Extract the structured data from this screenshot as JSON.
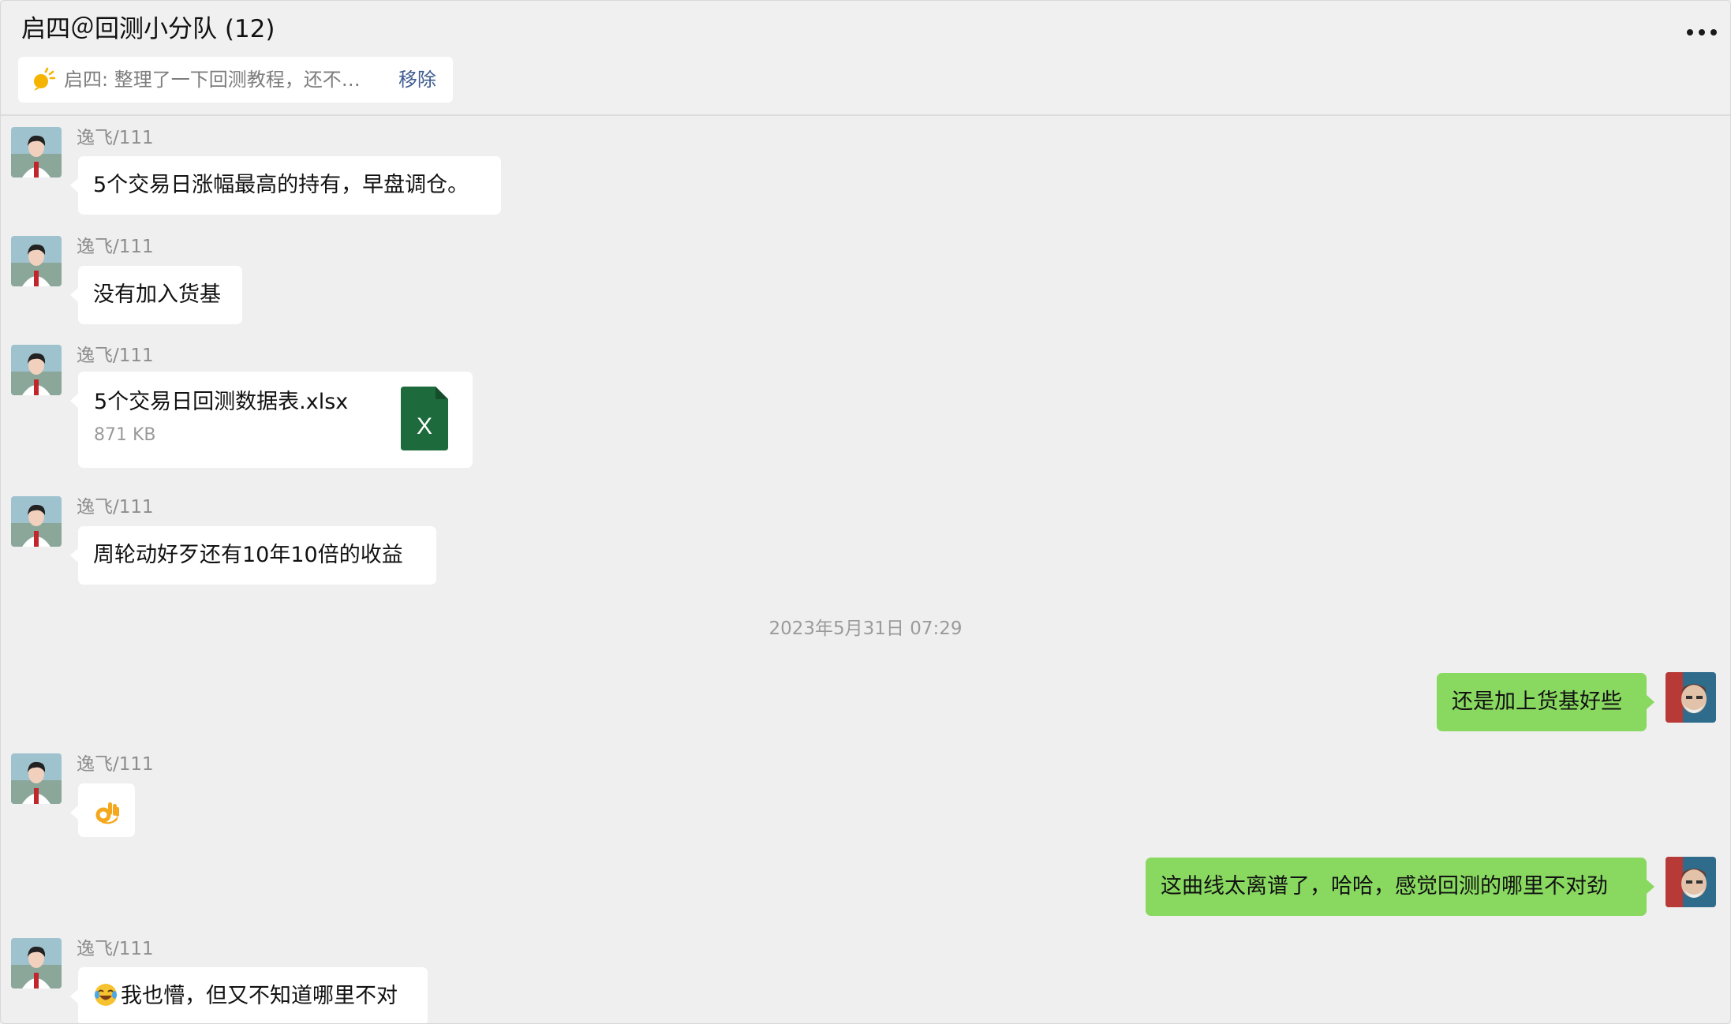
{
  "header": {
    "title": "启四＠回测小分队 (12)",
    "more_icon": "more-horizontal-icon",
    "pinned": {
      "icon": "pin-sun-icon",
      "text": "启四: 整理了一下回测教程，还不…",
      "remove_label": "移除"
    }
  },
  "colors": {
    "background": "#efefef",
    "incoming_bubble": "#ffffff",
    "outgoing_bubble": "#89d961",
    "link": "#3d5b8f",
    "excel_green": "#1d6b3c"
  },
  "messages": [
    {
      "sender": "逸飞/111",
      "text": "5个交易日涨幅最高的持有，早盘调仓。"
    },
    {
      "sender": "逸飞/111",
      "text": "没有加入货基"
    },
    {
      "sender": "逸飞/111",
      "file": {
        "name": "5个交易日回测数据表.xlsx",
        "size": "871 KB",
        "icon_letter": "X",
        "icon": "excel-file-icon"
      }
    },
    {
      "sender": "逸飞/111",
      "text": "周轮动好歹还有10年10倍的收益"
    },
    {
      "timestamp": "2023年5月31日 07:29"
    },
    {
      "sender": "me",
      "text": "还是加上货基好些"
    },
    {
      "sender": "逸飞/111",
      "emoji": "ok-hand-emoji"
    },
    {
      "sender": "me",
      "text": "这曲线太离谱了，哈哈，感觉回测的哪里不对劲"
    },
    {
      "sender": "逸飞/111",
      "emoji": "crying-laughing-emoji",
      "text": "我也懵，但又不知道哪里不对"
    }
  ]
}
